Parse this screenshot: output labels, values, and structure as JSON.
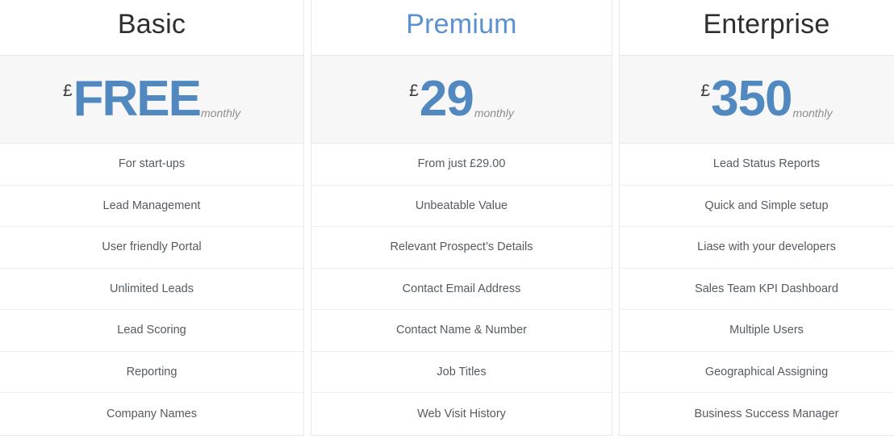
{
  "colors": {
    "price_blue": "#5188c0",
    "premium_title_blue": "#5b91cf",
    "title_dark": "#2f2f2f",
    "feature_text": "#555b61",
    "price_band_bg": "#f7f7f7",
    "border": "#e8e8e8",
    "period_gray": "#8d8d8d"
  },
  "plans": [
    {
      "name": "Basic",
      "currency": "£",
      "amount": "FREE",
      "period": "monthly",
      "features": [
        "For start-ups",
        "Lead Management",
        "User friendly Portal",
        "Unlimited Leads",
        "Lead Scoring",
        "Reporting",
        "Company Names"
      ]
    },
    {
      "name": "Premium",
      "currency": "£",
      "amount": "29",
      "period": "monthly",
      "features": [
        "From just £29.00",
        "Unbeatable Value",
        "Relevant Prospect’s Details",
        "Contact Email Address",
        "Contact Name & Number",
        "Job Titles",
        "Web Visit History"
      ]
    },
    {
      "name": "Enterprise",
      "currency": "£",
      "amount": "350",
      "period": "monthly",
      "features": [
        "Lead Status Reports",
        "Quick and Simple setup",
        "Liase with your developers",
        "Sales Team KPI Dashboard",
        "Multiple Users",
        "Geographical Assigning",
        "Business Success Manager"
      ]
    }
  ]
}
